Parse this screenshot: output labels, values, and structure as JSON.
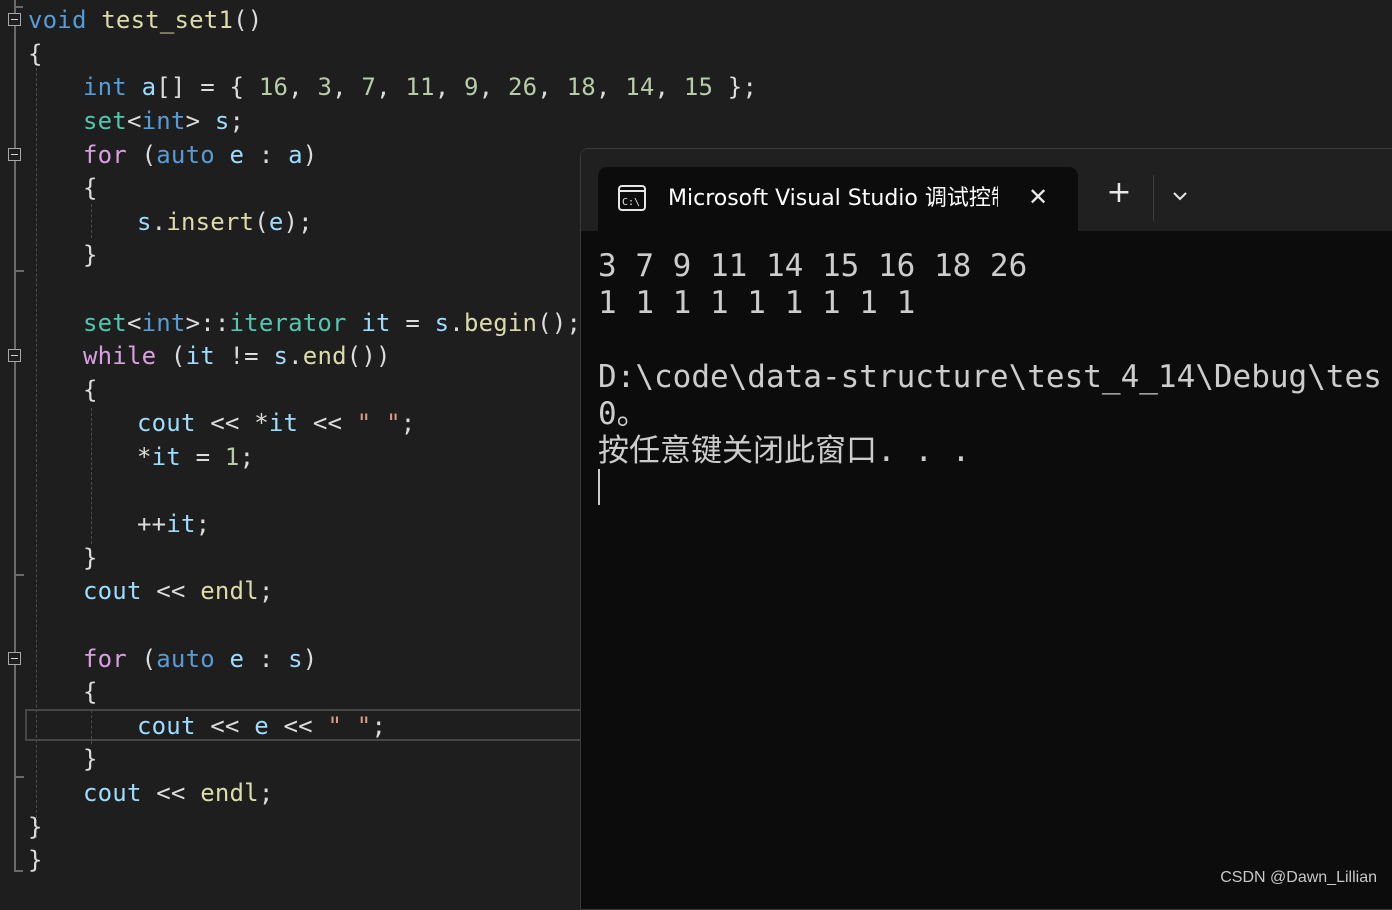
{
  "editor": {
    "lines": [
      {
        "segments": [
          {
            "t": "void",
            "c": "kw"
          },
          {
            "t": " "
          },
          {
            "t": "test_set1",
            "c": "fn"
          },
          {
            "t": "()"
          }
        ]
      },
      {
        "segments": [
          {
            "t": "{"
          }
        ]
      },
      {
        "segments": [
          {
            "t": "int",
            "c": "kw"
          },
          {
            "t": " "
          },
          {
            "t": "a",
            "c": "vr"
          },
          {
            "t": "[] = { "
          },
          {
            "t": "16",
            "c": "nm"
          },
          {
            "t": ", "
          },
          {
            "t": "3",
            "c": "nm"
          },
          {
            "t": ", "
          },
          {
            "t": "7",
            "c": "nm"
          },
          {
            "t": ", "
          },
          {
            "t": "11",
            "c": "nm"
          },
          {
            "t": ", "
          },
          {
            "t": "9",
            "c": "nm"
          },
          {
            "t": ", "
          },
          {
            "t": "26",
            "c": "nm"
          },
          {
            "t": ", "
          },
          {
            "t": "18",
            "c": "nm"
          },
          {
            "t": ", "
          },
          {
            "t": "14",
            "c": "nm"
          },
          {
            "t": ", "
          },
          {
            "t": "15",
            "c": "nm"
          },
          {
            "t": " };"
          }
        ]
      },
      {
        "segments": [
          {
            "t": "set",
            "c": "ty"
          },
          {
            "t": "<"
          },
          {
            "t": "int",
            "c": "kw"
          },
          {
            "t": "> "
          },
          {
            "t": "s",
            "c": "vr"
          },
          {
            "t": ";"
          }
        ]
      },
      {
        "segments": [
          {
            "t": "for",
            "c": "ct"
          },
          {
            "t": " ("
          },
          {
            "t": "auto",
            "c": "kw"
          },
          {
            "t": " "
          },
          {
            "t": "e",
            "c": "vr"
          },
          {
            "t": " : "
          },
          {
            "t": "a",
            "c": "vr"
          },
          {
            "t": ")"
          }
        ]
      },
      {
        "segments": [
          {
            "t": "{"
          }
        ]
      },
      {
        "segments": [
          {
            "t": "s",
            "c": "vr"
          },
          {
            "t": "."
          },
          {
            "t": "insert",
            "c": "fn"
          },
          {
            "t": "("
          },
          {
            "t": "e",
            "c": "vr"
          },
          {
            "t": ");"
          }
        ]
      },
      {
        "segments": [
          {
            "t": "}"
          }
        ]
      },
      {
        "segments": [
          {
            "t": ""
          }
        ]
      },
      {
        "segments": [
          {
            "t": "set",
            "c": "ty"
          },
          {
            "t": "<"
          },
          {
            "t": "int",
            "c": "kw"
          },
          {
            "t": ">::"
          },
          {
            "t": "iterator",
            "c": "ty"
          },
          {
            "t": " "
          },
          {
            "t": "it",
            "c": "vr"
          },
          {
            "t": " = "
          },
          {
            "t": "s",
            "c": "vr"
          },
          {
            "t": "."
          },
          {
            "t": "begin",
            "c": "fn"
          },
          {
            "t": "();"
          }
        ]
      },
      {
        "segments": [
          {
            "t": "while",
            "c": "ct"
          },
          {
            "t": " ("
          },
          {
            "t": "it",
            "c": "vr"
          },
          {
            "t": " != "
          },
          {
            "t": "s",
            "c": "vr"
          },
          {
            "t": "."
          },
          {
            "t": "end",
            "c": "fn"
          },
          {
            "t": "())"
          }
        ]
      },
      {
        "segments": [
          {
            "t": "{"
          }
        ]
      },
      {
        "segments": [
          {
            "t": "cout",
            "c": "vr"
          },
          {
            "t": " << *"
          },
          {
            "t": "it",
            "c": "vr"
          },
          {
            "t": " << "
          },
          {
            "t": "\" \"",
            "c": "st"
          },
          {
            "t": ";"
          }
        ]
      },
      {
        "segments": [
          {
            "t": "*"
          },
          {
            "t": "it",
            "c": "vr"
          },
          {
            "t": " = "
          },
          {
            "t": "1",
            "c": "nm"
          },
          {
            "t": ";"
          }
        ]
      },
      {
        "segments": [
          {
            "t": ""
          }
        ]
      },
      {
        "segments": [
          {
            "t": "++"
          },
          {
            "t": "it",
            "c": "vr"
          },
          {
            "t": ";"
          }
        ]
      },
      {
        "segments": [
          {
            "t": "}"
          }
        ]
      },
      {
        "segments": [
          {
            "t": "cout",
            "c": "vr"
          },
          {
            "t": " << "
          },
          {
            "t": "endl",
            "c": "fn"
          },
          {
            "t": ";"
          }
        ]
      },
      {
        "segments": [
          {
            "t": ""
          }
        ]
      },
      {
        "segments": [
          {
            "t": "for",
            "c": "ct"
          },
          {
            "t": " ("
          },
          {
            "t": "auto",
            "c": "kw"
          },
          {
            "t": " "
          },
          {
            "t": "e",
            "c": "vr"
          },
          {
            "t": " : "
          },
          {
            "t": "s",
            "c": "vr"
          },
          {
            "t": ")"
          }
        ]
      },
      {
        "segments": [
          {
            "t": "{"
          }
        ]
      },
      {
        "segments": [
          {
            "t": "cout",
            "c": "vr"
          },
          {
            "t": " << "
          },
          {
            "t": "e",
            "c": "vr"
          },
          {
            "t": " << "
          },
          {
            "t": "\" \"",
            "c": "st"
          },
          {
            "t": ";"
          }
        ]
      },
      {
        "segments": [
          {
            "t": "}"
          }
        ]
      },
      {
        "segments": [
          {
            "t": "cout",
            "c": "vr"
          },
          {
            "t": " << "
          },
          {
            "t": "endl",
            "c": "fn"
          },
          {
            "t": ";"
          }
        ]
      },
      {
        "segments": [
          {
            "t": "}"
          }
        ]
      },
      {
        "segments": [
          {
            "t": "}"
          }
        ]
      }
    ]
  },
  "terminal": {
    "tab_title": "Microsoft Visual Studio 调试控制台",
    "tab_icon": "console-icon",
    "close_glyph": "✕",
    "new_tab_glyph": "+",
    "dropdown_icon": "chevron-down-icon",
    "output": [
      "3 7 9 11 14 15 16 18 26",
      "1 1 1 1 1 1 1 1 1",
      "",
      "D:\\code\\data-structure\\test_4_14\\Debug\\tes",
      "0。",
      "按任意键关闭此窗口. . ."
    ]
  },
  "watermark": "CSDN @Dawn_Lillian",
  "colors": {
    "editor_bg": "#1e1e1e",
    "keyword": "#569cd6",
    "control": "#d8a0df",
    "type": "#4ec9b0",
    "variable": "#9cdcfe",
    "function": "#dcdcaa",
    "number": "#b5cea8",
    "string": "#d69d85",
    "terminal_bg": "#0c0c0c"
  }
}
